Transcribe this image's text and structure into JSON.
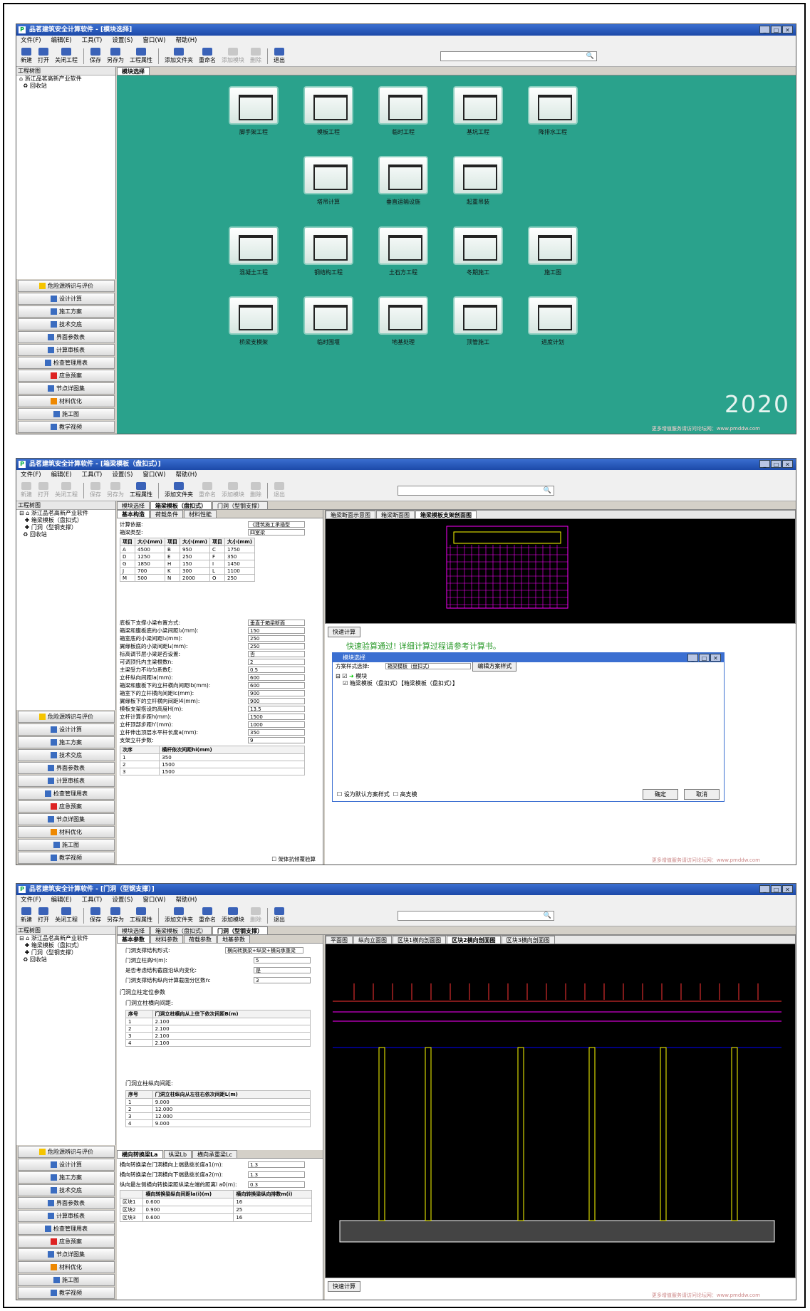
{
  "app": {
    "title1": "品茗建筑安全计算软件 - [模块选择]",
    "title2": "品茗建筑安全计算软件 - [箱梁模板（盘扣式）]",
    "title3": "品茗建筑安全计算软件 - [门洞（型钢支撑）]"
  },
  "menu": [
    "文件(F)",
    "编辑(E)",
    "工具(T)",
    "设置(S)",
    "窗口(W)",
    "帮助(H)"
  ],
  "toolbar": [
    "新建",
    "打开",
    "关闭工程",
    "保存",
    "另存为",
    "工程属性",
    "添加文件夹",
    "重命名",
    "添加模块",
    "删除",
    "退出"
  ],
  "tree": {
    "header": "工程树图",
    "root": "浙江品茗高新产业软件",
    "recycle": "回收站",
    "child1": "箱梁模板（盘扣式）",
    "child2": "门洞（型钢支撑）"
  },
  "nav": [
    "危险源辨识与评价",
    "设计计算",
    "施工方案",
    "技术交底",
    "界面参数表",
    "计算审核表",
    "检查管理用表",
    "应急预案",
    "节点详图集",
    "材料优化",
    "施工图",
    "教学视频"
  ],
  "s1": {
    "tab": "模块选择",
    "modules": [
      "脚手架工程",
      "模板工程",
      "临时工程",
      "基坑工程",
      "降排水工程",
      "塔吊计算",
      "垂直运输设施",
      "起重吊装",
      "混凝土工程",
      "钢结构工程",
      "土石方工程",
      "冬期施工",
      "施工图",
      "桥梁支模架",
      "临时围堰",
      "地基处理",
      "顶管施工",
      "进度计划"
    ],
    "badge": "2020",
    "footer": "更多增值服务请访问论坛网：www.pmddw.com"
  },
  "s2": {
    "tabs": [
      "模块选择",
      "箱梁模板（盘扣式）",
      "门洞（型钢支撑）"
    ],
    "subtabs": [
      "基本构造",
      "荷载条件",
      "材料性能"
    ],
    "basis_label": "计算依据:",
    "basis": "《建筑施工承插型",
    "beam_label": "箱梁类型:",
    "beam": "四室梁",
    "dims_head": [
      "项目",
      "大小(mm)",
      "项目",
      "大小(mm)",
      "项目",
      "大小(mm)"
    ],
    "dims": [
      [
        "A",
        "4500",
        "B",
        "950",
        "C",
        "1750"
      ],
      [
        "D",
        "1250",
        "E",
        "250",
        "F",
        "350"
      ],
      [
        "G",
        "1850",
        "H",
        "150",
        "I",
        "1450"
      ],
      [
        "J",
        "700",
        "K",
        "300",
        "L",
        "1100"
      ],
      [
        "M",
        "500",
        "N",
        "2000",
        "O",
        "250"
      ]
    ],
    "params": [
      [
        "底板下支撑小梁布置方式:",
        "垂直于箱梁断面"
      ],
      [
        "箱梁和腹板底的小梁间距l₂(mm):",
        "150"
      ],
      [
        "箱室底的小梁间距l₃(mm):",
        "250"
      ],
      [
        "翼缘板底的小梁间距l₄(mm):",
        "250"
      ],
      [
        "标高调节层小梁是否设置:",
        "否"
      ],
      [
        "可调顶托内主梁根数n:",
        "2"
      ],
      [
        "主梁受力不均匀系数ξ:",
        "0.5"
      ],
      [
        "立杆纵向间距la(mm):",
        "600"
      ],
      [
        "箱梁和腹板下的立杆横向间距lb(mm):",
        "600"
      ],
      [
        "箱室下的立杆横向间距lc(mm):",
        "900"
      ],
      [
        "翼缘板下的立杆横向间距l4(mm):",
        "900"
      ],
      [
        "模板支架搭设的高度H(m):",
        "13.5"
      ],
      [
        "立杆计算步距h(mm):",
        "1500"
      ],
      [
        "立杆顶部步距h'(mm):",
        "1000"
      ],
      [
        "立杆伸出顶层水平杆长度a(mm):",
        "350"
      ],
      [
        "支架立杆步数:",
        "9"
      ]
    ],
    "step_head": [
      "次序",
      "横杆依次间距hi(mm)"
    ],
    "steps": [
      [
        "1",
        "350"
      ],
      [
        "2",
        "1500"
      ],
      [
        "3",
        "1500"
      ]
    ],
    "check": "架体抗倾覆验算",
    "right_tabs": [
      "箱梁断面示意图",
      "箱梁断面图",
      "箱梁模板支架剖面图"
    ],
    "calc_btn": "快速计算",
    "msg": "快速验算通过! 详细计算过程请参考计算书。",
    "dlg": {
      "title": "模块选择",
      "scheme_label": "方案样式选择:",
      "scheme": "箱梁模板（盘扣式）",
      "edit": "编辑方案样式",
      "root": "模块",
      "item": "箱梁模板（盘扣式）【箱梁模板（盘扣式）】",
      "default": "设为默认方案样式",
      "high": "高支模",
      "ok": "确定",
      "cancel": "取消"
    },
    "footer": "更多增值服务请访问论坛网：www.pmddw.com"
  },
  "s3": {
    "subtabs": [
      "基本参数",
      "材料参数",
      "荷载参数",
      "地基参数"
    ],
    "params": [
      [
        "门洞支撑结构形式:",
        "横向转换梁+纵梁+横向承重梁"
      ],
      [
        "门洞立柱高H(m):",
        "5"
      ],
      [
        "是否考虑结构截面沿纵向变化:",
        "是"
      ],
      [
        "门洞支撑结构纵向计算截面分区数n:",
        "3"
      ]
    ],
    "grp": "门洞立柱定位参数",
    "hlab": "门洞立柱横向间距:",
    "h_head": [
      "序号",
      "门洞立柱横向从上往下依次间距B(m)"
    ],
    "h_rows": [
      [
        "1",
        "2.100"
      ],
      [
        "2",
        "2.100"
      ],
      [
        "3",
        "2.100"
      ],
      [
        "4",
        "2.100"
      ]
    ],
    "vlab": "门洞立柱纵向间距:",
    "v_head": [
      "序号",
      "门洞立柱纵向从左往右依次间距L(m)"
    ],
    "v_rows": [
      [
        "1",
        "9.000"
      ],
      [
        "2",
        "12.000"
      ],
      [
        "3",
        "12.000"
      ],
      [
        "4",
        "9.000"
      ]
    ],
    "ltabs": [
      "横向转换梁La",
      "纵梁Lb",
      "横向承重梁Lc"
    ],
    "lparams": [
      [
        "横向转换梁在门洞横向上端悬挑长度a1(m):",
        "1.3"
      ],
      [
        "横向转换梁在门洞横向下端悬挑长度a2(m):",
        "1.3"
      ],
      [
        "纵向最左侧横向转换梁距纵梁左端的距离l a0(m):",
        "0.3"
      ]
    ],
    "z_head": [
      "",
      "横向转换梁纵向间距la(i)(m)",
      "横向转换梁纵向排数m(i)"
    ],
    "z_rows": [
      [
        "区块1",
        "0.600",
        "16"
      ],
      [
        "区块2",
        "0.900",
        "25"
      ],
      [
        "区块3",
        "0.600",
        "16"
      ]
    ],
    "right_tabs": [
      "平面图",
      "纵向立面图",
      "区块1横向剖面图",
      "区块2横向剖面图",
      "区块3横向剖面图"
    ],
    "calc_btn": "快速计算",
    "footer": "更多增值服务请访问论坛网：www.pmddw.com"
  }
}
